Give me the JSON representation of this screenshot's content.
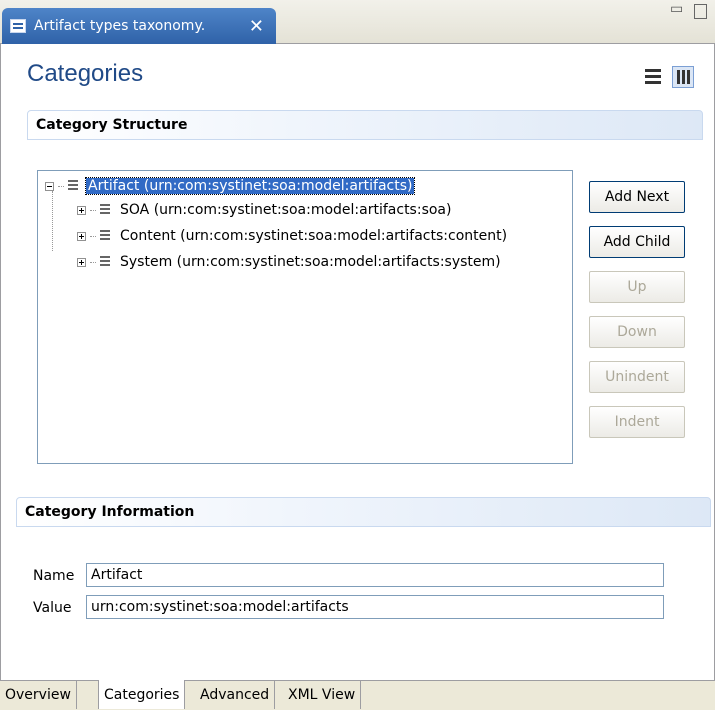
{
  "editor_tab": {
    "title": "Artifact types taxonomy.",
    "close": "✕",
    "icon": "taxonomy-icon"
  },
  "window_controls": {
    "minimize": "▭",
    "maximize": ""
  },
  "page": {
    "title": "Categories"
  },
  "category_structure": {
    "heading": "Category Structure",
    "tree": {
      "root": {
        "label": "Artifact (urn:com:systinet:soa:model:artifacts)",
        "expanded": true,
        "selected": true
      },
      "children": [
        {
          "label": "SOA (urn:com:systinet:soa:model:artifacts:soa)",
          "expanded": false
        },
        {
          "label": "Content (urn:com:systinet:soa:model:artifacts:content)",
          "expanded": false
        },
        {
          "label": "System (urn:com:systinet:soa:model:artifacts:system)",
          "expanded": false
        }
      ]
    },
    "buttons": {
      "add_next": "Add Next",
      "add_child": "Add Child",
      "up": "Up",
      "down": "Down",
      "unindent": "Unindent",
      "indent": "Indent"
    }
  },
  "category_information": {
    "heading": "Category Information",
    "name_label": "Name",
    "name_value": "Artifact",
    "value_label": "Value",
    "value_value": "urn:com:systinet:soa:model:artifacts"
  },
  "bottom_tabs": [
    "Overview",
    "Categories",
    "Advanced",
    "XML View"
  ],
  "colors": {
    "accent": "#204a87",
    "selection": "#316ac5",
    "tab_active": "#2f62a8"
  }
}
